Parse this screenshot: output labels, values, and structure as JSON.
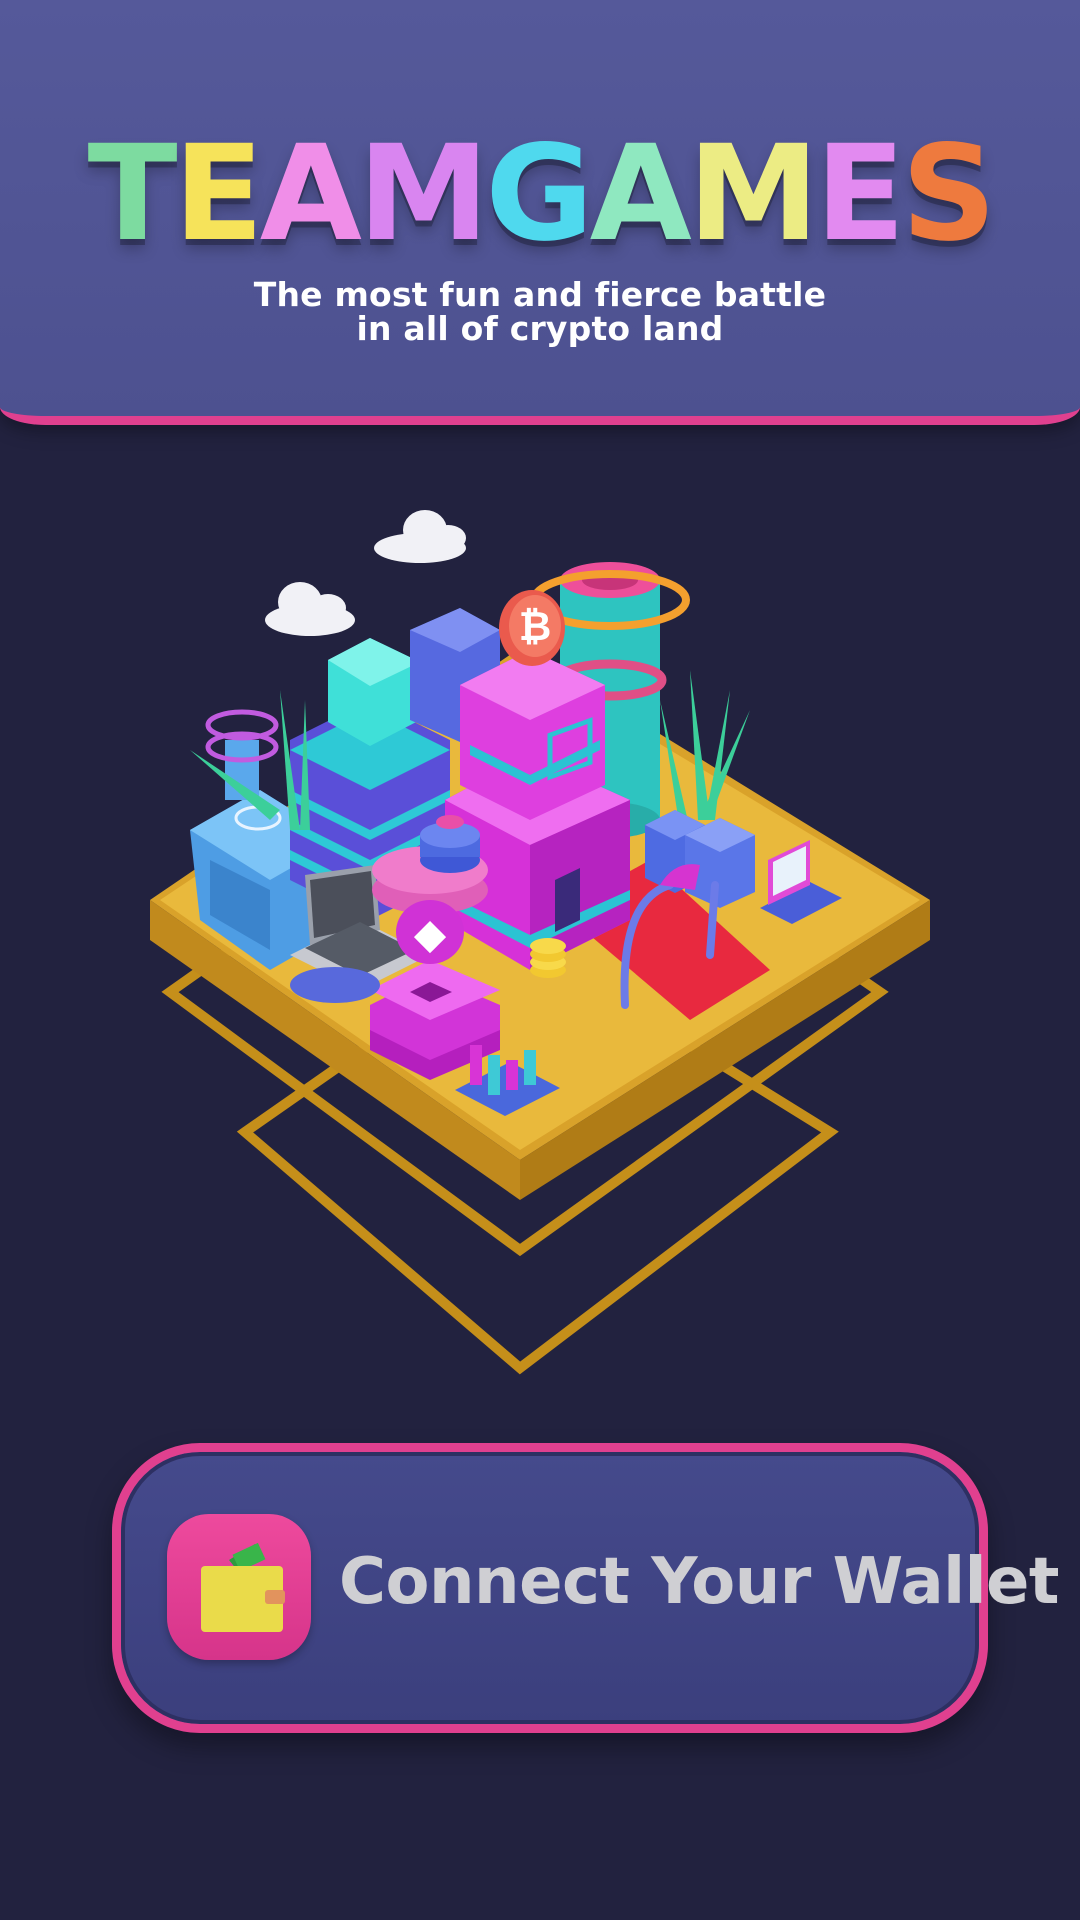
{
  "header": {
    "logo_letters": [
      {
        "char": "T",
        "color": "#7ddba0"
      },
      {
        "char": "E",
        "color": "#f6e35a"
      },
      {
        "char": "A",
        "color": "#f08ee8"
      },
      {
        "char": "M",
        "color": "#d985f0"
      },
      {
        "char": "G",
        "color": "#4fd9ee"
      },
      {
        "char": "A",
        "color": "#8fe8c0"
      },
      {
        "char": "M",
        "color": "#ecec84"
      },
      {
        "char": "E",
        "color": "#e28af0"
      },
      {
        "char": "S",
        "color": "#ee7a3e"
      }
    ],
    "tagline_line1": "The most fun and fierce battle",
    "tagline_line2": "in all of crypto land"
  },
  "hero": {
    "bitcoin_symbol": "₿",
    "ethereum_symbol": "◆"
  },
  "wallet_button": {
    "label": "Connect Your Wallet",
    "icon": "wallet-icon"
  },
  "colors": {
    "background": "#22223f",
    "header": "#55599a",
    "accent_pink": "#e0408f",
    "platform_gold": "#e8b435"
  }
}
